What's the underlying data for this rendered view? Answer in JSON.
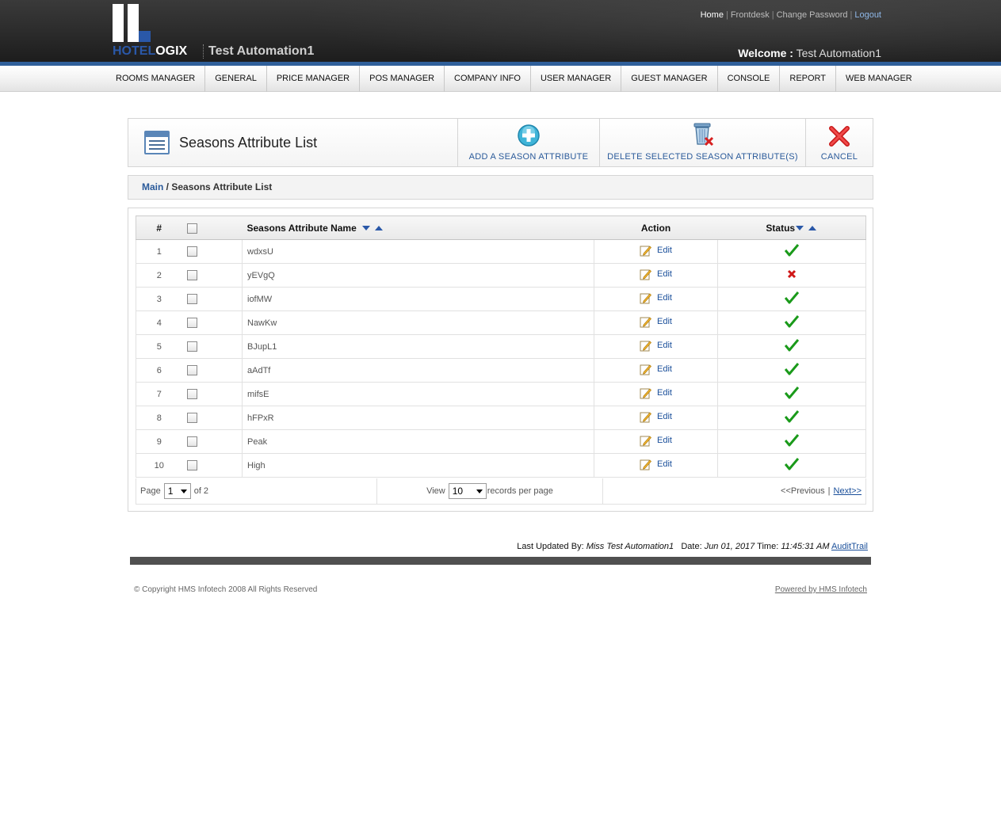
{
  "header": {
    "logo_text_a": "HOTEL",
    "logo_text_b": "OGIX",
    "tenant": "Test Automation1",
    "links": [
      {
        "label": "Home",
        "sep": "|"
      },
      {
        "label": "Frontdesk",
        "sep": "|"
      },
      {
        "label": "Change Password",
        "sep": "|"
      },
      {
        "label": "Logout",
        "sep": ""
      }
    ],
    "welcome_label": "Welcome :",
    "welcome_user": "Test Automation1"
  },
  "nav": [
    "ROOMS MANAGER",
    "GENERAL",
    "PRICE MANAGER",
    "POS MANAGER",
    "COMPANY INFO",
    "USER MANAGER",
    "GUEST MANAGER",
    "CONSOLE",
    "REPORT",
    "WEB MANAGER"
  ],
  "title_panel": {
    "title": "Seasons Attribute List",
    "add_label": "ADD A SEASON ATTRIBUTE",
    "delete_label": "DELETE SELECTED SEASON ATTRIBUTE(S)",
    "cancel_label": "CANCEL"
  },
  "breadcrumb": {
    "main": "Main",
    "sep": " / ",
    "current": "Seasons Attribute List"
  },
  "table": {
    "headers": {
      "num": "#",
      "name": "Seasons Attribute Name",
      "action": "Action",
      "status": "Status"
    },
    "rows": [
      {
        "num": "1",
        "name": "wdxsU",
        "action": "Edit",
        "active": true
      },
      {
        "num": "2",
        "name": "yEVgQ",
        "action": "Edit",
        "active": false
      },
      {
        "num": "3",
        "name": "iofMW",
        "action": "Edit",
        "active": true
      },
      {
        "num": "4",
        "name": "NawKw",
        "action": "Edit",
        "active": true
      },
      {
        "num": "5",
        "name": "BJupL1",
        "action": "Edit",
        "active": true
      },
      {
        "num": "6",
        "name": "aAdTf",
        "action": "Edit",
        "active": true
      },
      {
        "num": "7",
        "name": "mifsE",
        "action": "Edit",
        "active": true
      },
      {
        "num": "8",
        "name": "hFPxR",
        "action": "Edit",
        "active": true
      },
      {
        "num": "9",
        "name": "Peak",
        "action": "Edit",
        "active": true
      },
      {
        "num": "10",
        "name": "High",
        "action": "Edit",
        "active": true
      }
    ]
  },
  "pager": {
    "page_label": "Page",
    "page_value": "1",
    "of_label": "of 2",
    "view_label": "View",
    "view_value": "10",
    "per_page_label": "records per page",
    "prev_label": "<<Previous",
    "sep": "|",
    "next_label": "Next>>"
  },
  "footer": {
    "updated_label": "Last Updated By:",
    "updated_by": "Miss Test Automation1",
    "date_label": "Date:",
    "date_value": "Jun 01, 2017",
    "time_label": "Time:",
    "time_value": "11:45:31 AM",
    "audit_link": "AuditTrail",
    "copyright": "© Copyright HMS Infotech 2008 All Rights Reserved",
    "powered": "Powered by HMS Infotech"
  },
  "colors": {
    "accent": "#2a58a8",
    "link": "#1a4f9a",
    "check": "#1a9a1a",
    "cross": "#d01818"
  }
}
